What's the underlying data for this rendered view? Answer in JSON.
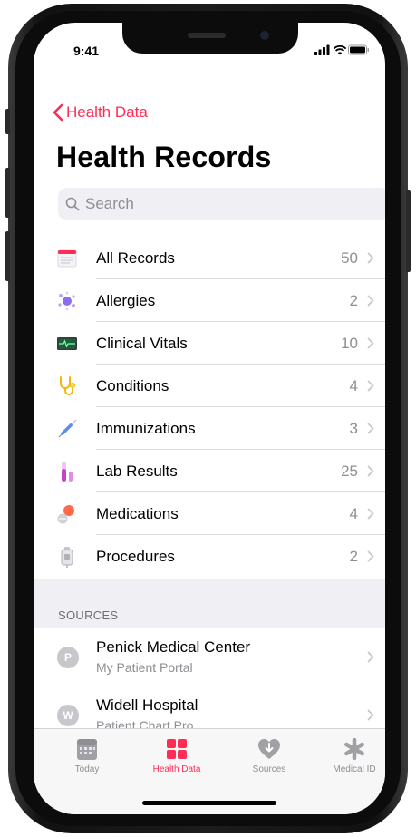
{
  "status_bar": {
    "time": "9:41"
  },
  "nav": {
    "back_label": "Health Data",
    "title": "Health Records"
  },
  "search": {
    "placeholder": "Search"
  },
  "records": [
    {
      "label": "All Records",
      "count": "50",
      "icon": "all-records-icon",
      "color": "#ff2d55"
    },
    {
      "label": "Allergies",
      "count": "2",
      "icon": "allergies-icon",
      "color": "#8e6cf0"
    },
    {
      "label": "Clinical Vitals",
      "count": "10",
      "icon": "clinical-vitals-icon",
      "color": "#2a7f4a"
    },
    {
      "label": "Conditions",
      "count": "4",
      "icon": "stethoscope-icon",
      "color": "#f5b800"
    },
    {
      "label": "Immunizations",
      "count": "3",
      "icon": "syringe-icon",
      "color": "#5b8def"
    },
    {
      "label": "Lab Results",
      "count": "25",
      "icon": "test-tube-icon",
      "color": "#c643c6"
    },
    {
      "label": "Medications",
      "count": "4",
      "icon": "pills-icon",
      "color": "#ff6b4a"
    },
    {
      "label": "Procedures",
      "count": "2",
      "icon": "procedures-icon",
      "color": "#b0b0b5"
    }
  ],
  "sources": {
    "header": "SOURCES",
    "items": [
      {
        "initial": "P",
        "name": "Penick Medical Center",
        "subtitle": "My Patient Portal"
      },
      {
        "initial": "W",
        "name": "Widell Hospital",
        "subtitle": "Patient Chart Pro"
      }
    ]
  },
  "tabbar": {
    "tabs": [
      {
        "label": "Today",
        "icon": "today-icon",
        "active": false
      },
      {
        "label": "Health Data",
        "icon": "health-data-grid-icon",
        "active": true
      },
      {
        "label": "Sources",
        "icon": "sources-heart-icon",
        "active": false
      },
      {
        "label": "Medical ID",
        "icon": "medical-id-asterisk-icon",
        "active": false
      }
    ]
  },
  "colors": {
    "accent": "#ff2d55",
    "secondary_text": "#8e8e93",
    "group_background": "#efeff4"
  }
}
